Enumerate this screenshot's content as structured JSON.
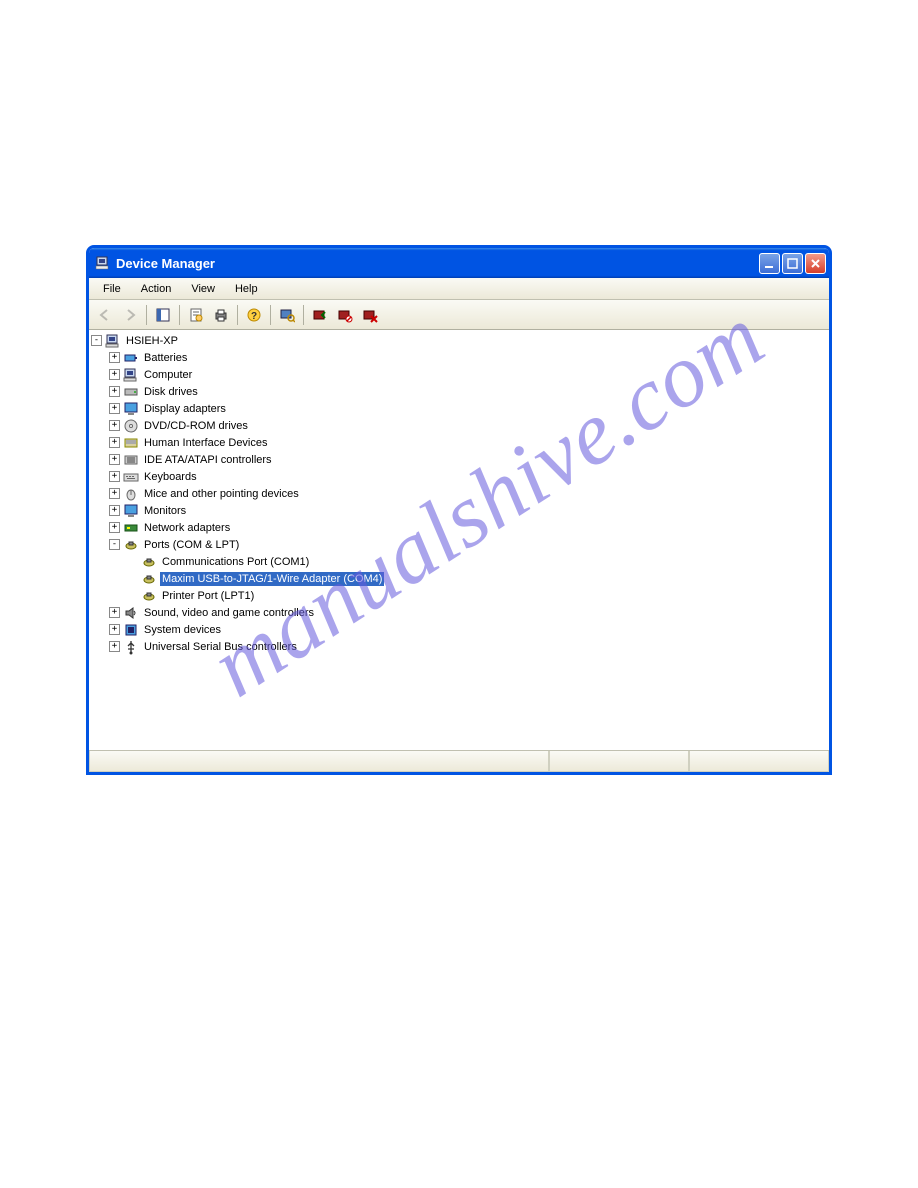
{
  "window": {
    "title": "Device Manager"
  },
  "menubar": [
    "File",
    "Action",
    "View",
    "Help"
  ],
  "tree": {
    "root": "HSIEH-XP",
    "nodes": [
      {
        "label": "Batteries",
        "icon": "battery-icon"
      },
      {
        "label": "Computer",
        "icon": "computer-icon"
      },
      {
        "label": "Disk drives",
        "icon": "disk-icon"
      },
      {
        "label": "Display adapters",
        "icon": "monitor-icon"
      },
      {
        "label": "DVD/CD-ROM drives",
        "icon": "cd-icon"
      },
      {
        "label": "Human Interface Devices",
        "icon": "hid-icon"
      },
      {
        "label": "IDE ATA/ATAPI controllers",
        "icon": "ide-icon"
      },
      {
        "label": "Keyboards",
        "icon": "keyboard-icon"
      },
      {
        "label": "Mice and other pointing devices",
        "icon": "mouse-icon"
      },
      {
        "label": "Monitors",
        "icon": "monitor-icon"
      },
      {
        "label": "Network adapters",
        "icon": "network-icon"
      }
    ],
    "ports": {
      "label": "Ports (COM & LPT)",
      "children": [
        {
          "label": "Communications Port (COM1)",
          "selected": false
        },
        {
          "label": "Maxim USB-to-JTAG/1-Wire Adapter (COM4)",
          "selected": true
        },
        {
          "label": "Printer Port (LPT1)",
          "selected": false
        }
      ]
    },
    "tail": [
      {
        "label": "Sound, video and game controllers",
        "icon": "sound-icon"
      },
      {
        "label": "System devices",
        "icon": "system-icon"
      },
      {
        "label": "Universal Serial Bus controllers",
        "icon": "usb-icon"
      }
    ]
  },
  "watermark": "manualshive.com"
}
